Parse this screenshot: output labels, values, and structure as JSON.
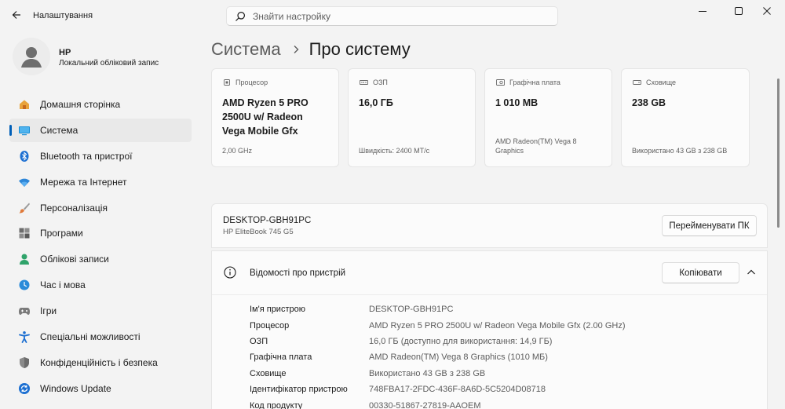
{
  "app": {
    "title": "Налаштування"
  },
  "search": {
    "placeholder": "Знайти настройку"
  },
  "profile": {
    "name": "HP",
    "account_type": "Локальний обліковий запис"
  },
  "sidebar": {
    "items": [
      {
        "label": "Домашня сторінка",
        "icon": "home-icon"
      },
      {
        "label": "Система",
        "icon": "system-icon",
        "active": true
      },
      {
        "label": "Bluetooth та пристрої",
        "icon": "bluetooth-icon"
      },
      {
        "label": "Мережа та Інтернет",
        "icon": "wifi-icon"
      },
      {
        "label": "Персоналізація",
        "icon": "brush-icon"
      },
      {
        "label": "Програми",
        "icon": "apps-icon"
      },
      {
        "label": "Облікові записи",
        "icon": "accounts-icon"
      },
      {
        "label": "Час і мова",
        "icon": "time-language-icon"
      },
      {
        "label": "Ігри",
        "icon": "gaming-icon"
      },
      {
        "label": "Спеціальні можливості",
        "icon": "accessibility-icon"
      },
      {
        "label": "Конфіденційність і безпека",
        "icon": "shield-icon"
      },
      {
        "label": "Windows Update",
        "icon": "windows-update-icon"
      }
    ]
  },
  "breadcrumb": {
    "parent": "Система",
    "current": "Про систему"
  },
  "specs": {
    "cpu": {
      "label": "Процесор",
      "line1": "AMD Ryzen 5 PRO",
      "line2": "2500U w/ Radeon",
      "line3": "Vega Mobile Gfx",
      "sub": "2,00 GHz"
    },
    "ram": {
      "label": "ОЗП",
      "value": "16,0 ГБ",
      "sub": "Швидкість: 2400 MT/с"
    },
    "gpu": {
      "label": "Графічна плата",
      "value": "1 010 MB",
      "sub1": "AMD Radeon(TM) Vega 8",
      "sub2": "Graphics"
    },
    "storage": {
      "label": "Сховище",
      "value": "238 GB",
      "sub": "Використано 43 GB з 238 GB"
    }
  },
  "device": {
    "name": "DESKTOP-GBH91PC",
    "model": "HP EliteBook 745 G5",
    "rename_label": "Перейменувати ПК"
  },
  "device_info": {
    "title": "Відомості про пристрій",
    "copy_label": "Копіювати",
    "rows": [
      {
        "key": "Ім'я пристрою",
        "value": "DESKTOP-GBH91PC"
      },
      {
        "key": "Процесор",
        "value": "AMD Ryzen 5 PRO 2500U w/ Radeon Vega Mobile Gfx (2.00 GHz)"
      },
      {
        "key": "ОЗП",
        "value": "16,0 ГБ (доступно для використання: 14,9 ГБ)"
      },
      {
        "key": "Графічна плата",
        "value": "AMD Radeon(TM) Vega 8 Graphics (1010 МБ)"
      },
      {
        "key": "Сховище",
        "value": "Використано 43 GB з 238 GB"
      },
      {
        "key": "Ідентифікатор пристрою",
        "value": "748FBA17-2FDC-436F-8A6D-5C5204D08718"
      },
      {
        "key": "Код продукту",
        "value": "00330-51867-27819-AAOEM"
      }
    ]
  },
  "colors": {
    "accent": "#005fb8",
    "background": "#f3f3f3",
    "card": "#fbfbfb"
  }
}
